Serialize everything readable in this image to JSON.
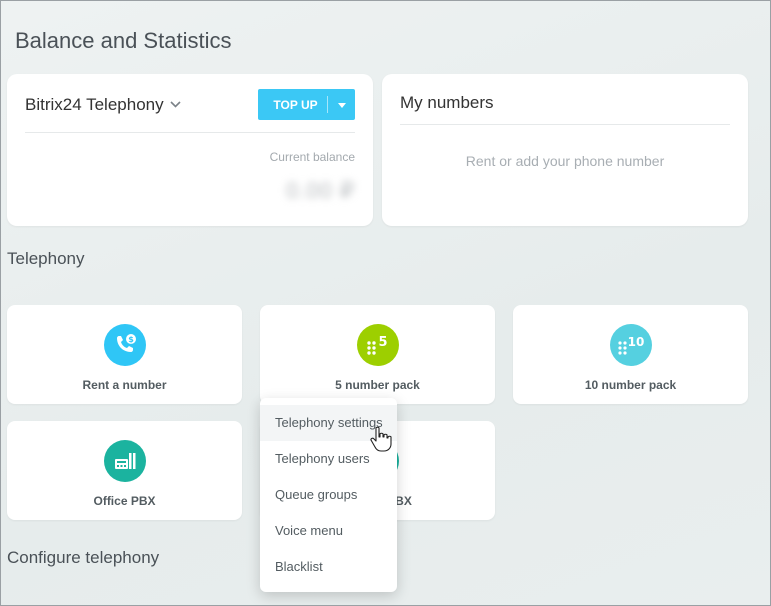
{
  "page": {
    "title": "Balance and Statistics"
  },
  "balance_card": {
    "provider": "Bitrix24 Telephony",
    "topup_label": "TOP UP",
    "current_balance_label": "Current balance",
    "balance_value": "0.00 ₽"
  },
  "numbers_card": {
    "title": "My numbers",
    "hint": "Rent or add your phone number"
  },
  "telephony": {
    "title": "Telephony",
    "tiles": [
      {
        "label": "Rent a number",
        "icon": "phone-dollar-icon",
        "color": "#2fc6f6",
        "glyph": "$"
      },
      {
        "label": "5 number pack",
        "icon": "number-pack-5-icon",
        "color": "#9dcf00",
        "glyph": "5"
      },
      {
        "label": "10 number pack",
        "icon": "number-pack-10-icon",
        "color": "#55d0e0",
        "glyph": "10"
      },
      {
        "label": "Office PBX",
        "icon": "office-pbx-icon",
        "color": "#1bb39f",
        "glyph": ""
      },
      {
        "label": "BX",
        "icon": "cloud-pbx-icon",
        "color": "#1bb39f",
        "glyph": ""
      }
    ]
  },
  "configure": {
    "title": "Configure telephony"
  },
  "menu": {
    "items": [
      {
        "label": "Telephony settings"
      },
      {
        "label": "Telephony users"
      },
      {
        "label": "Queue groups"
      },
      {
        "label": "Voice menu"
      },
      {
        "label": "Blacklist"
      }
    ]
  }
}
